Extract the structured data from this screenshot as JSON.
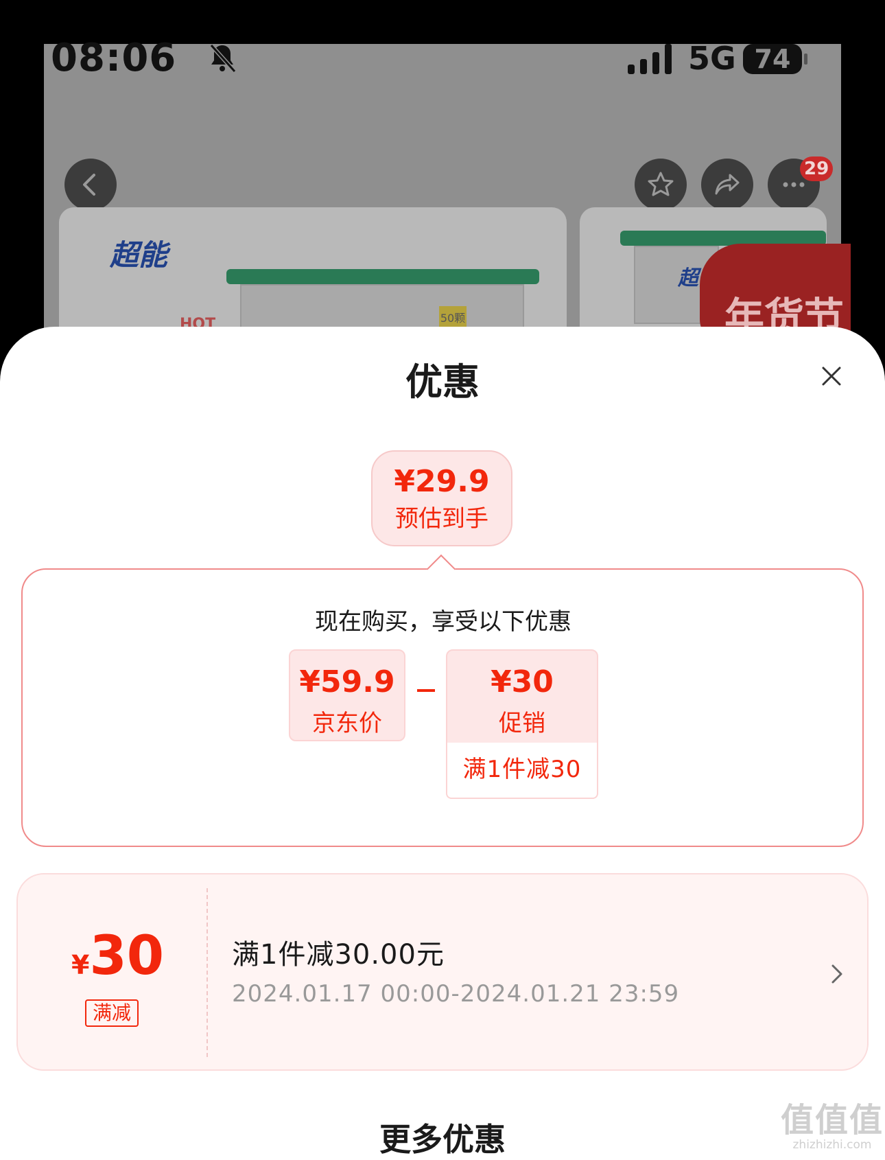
{
  "status_bar": {
    "time": "08:06",
    "network": "5G",
    "battery": "74"
  },
  "top_actions": {
    "badge_count": "29"
  },
  "product_images": {
    "brand_text": "超能",
    "hot_text": "HOT",
    "count_text": "50颗",
    "sale_text": "年货节"
  },
  "sheet": {
    "title": "优惠"
  },
  "estimate": {
    "price": "¥29.9",
    "label": "预估到手"
  },
  "promo": {
    "intro": "现在购买，享受以下优惠",
    "jd_price": {
      "value": "¥59.9",
      "label": "京东价"
    },
    "discount": {
      "value": "¥30",
      "label": "促销",
      "rule": "满1件减30"
    }
  },
  "coupon": {
    "currency": "¥",
    "amount": "30",
    "type": "满减",
    "title": "满1件减30.00元",
    "valid_period": "2024.01.17 00:00-2024.01.21 23:59"
  },
  "more": {
    "title": "更多优惠"
  },
  "watermark": {
    "glyphs": "值值值",
    "url": "zhizhizhi.com"
  },
  "colors": {
    "accent": "#f2270c",
    "tile_bg": "#fde7e7",
    "coupon_bg": "#fff4f3",
    "border": "#f08a8a"
  }
}
